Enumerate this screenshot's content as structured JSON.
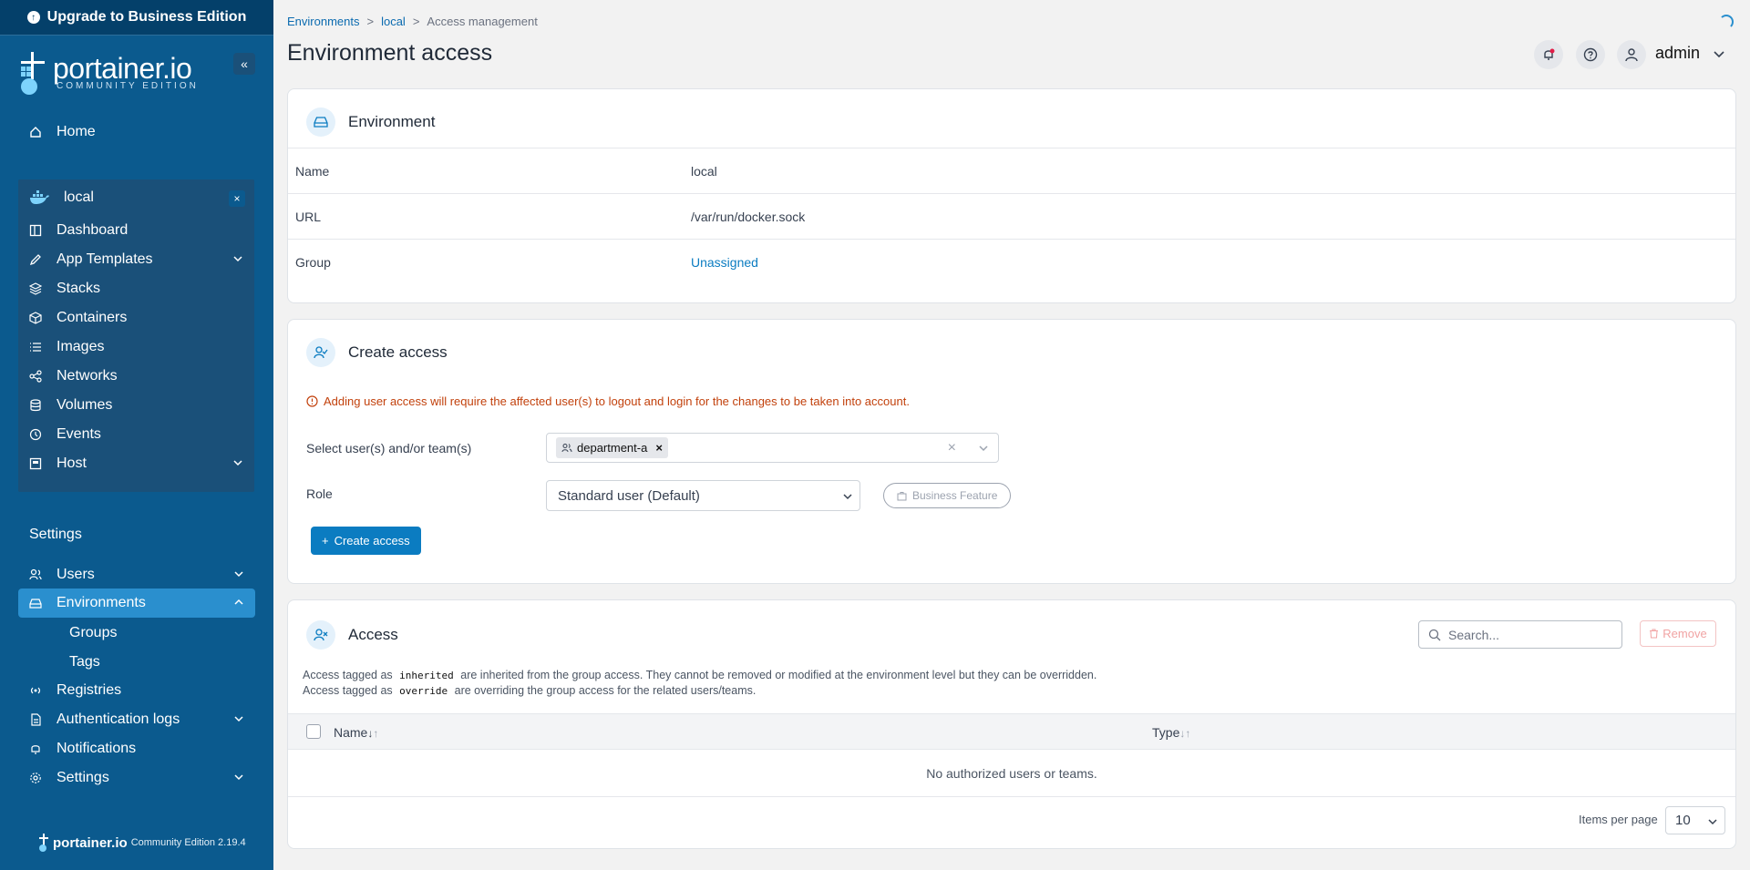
{
  "sidebar": {
    "upgrade_label": "Upgrade to Business Edition",
    "logo_text": "portainer.io",
    "logo_sub": "COMMUNITY EDITION",
    "home": "Home",
    "environment": {
      "name": "local",
      "items": {
        "dashboard": "Dashboard",
        "app_templates": "App Templates",
        "stacks": "Stacks",
        "containers": "Containers",
        "images": "Images",
        "networks": "Networks",
        "volumes": "Volumes",
        "events": "Events",
        "host": "Host"
      }
    },
    "settings_title": "Settings",
    "settings_items": {
      "users": "Users",
      "environments": "Environments",
      "groups": "Groups",
      "tags": "Tags",
      "registries": "Registries",
      "auth_logs": "Authentication logs",
      "notifications": "Notifications",
      "settings": "Settings"
    },
    "footer": {
      "brand": "portainer.io",
      "edition": "Community Edition 2.19.4"
    }
  },
  "header": {
    "breadcrumb": [
      "Environments",
      ">",
      "local",
      ">",
      "Access management"
    ],
    "title": "Environment access",
    "user": "admin"
  },
  "environment_card": {
    "title": "Environment",
    "rows": [
      {
        "key": "Name",
        "value": "local"
      },
      {
        "key": "URL",
        "value": "/var/run/docker.sock"
      },
      {
        "key": "Group",
        "value": "Unassigned"
      }
    ]
  },
  "create_access": {
    "title": "Create access",
    "warning": "Adding user access will require the affected user(s) to logout and login for the changes to be taken into account.",
    "select_label": "Select user(s) and/or team(s)",
    "selected_chip": "department-a",
    "role_label": "Role",
    "role_value": "Standard user (Default)",
    "business_feature": "Business Feature",
    "create_button": "Create access"
  },
  "access_card": {
    "title": "Access",
    "search_placeholder": "Search...",
    "remove_button": "Remove",
    "note1_pre": "Access tagged as",
    "note1_code": "inherited",
    "note1_post": "are inherited from the group access. They cannot be removed or modified at the environment level but they can be overridden.",
    "note2_pre": "Access tagged as",
    "note2_code": "override",
    "note2_post": "are overriding the group access for the related users/teams.",
    "columns": [
      "Name",
      "Type"
    ],
    "empty_text": "No authorized users or teams.",
    "items_per_page_label": "Items per page",
    "items_per_page_value": "10"
  },
  "colors": {
    "sidebar_bg": "#0b5a8e",
    "accent": "#0b7cc1",
    "active_nav": "#2a8fce",
    "warning": "#c2410c"
  }
}
